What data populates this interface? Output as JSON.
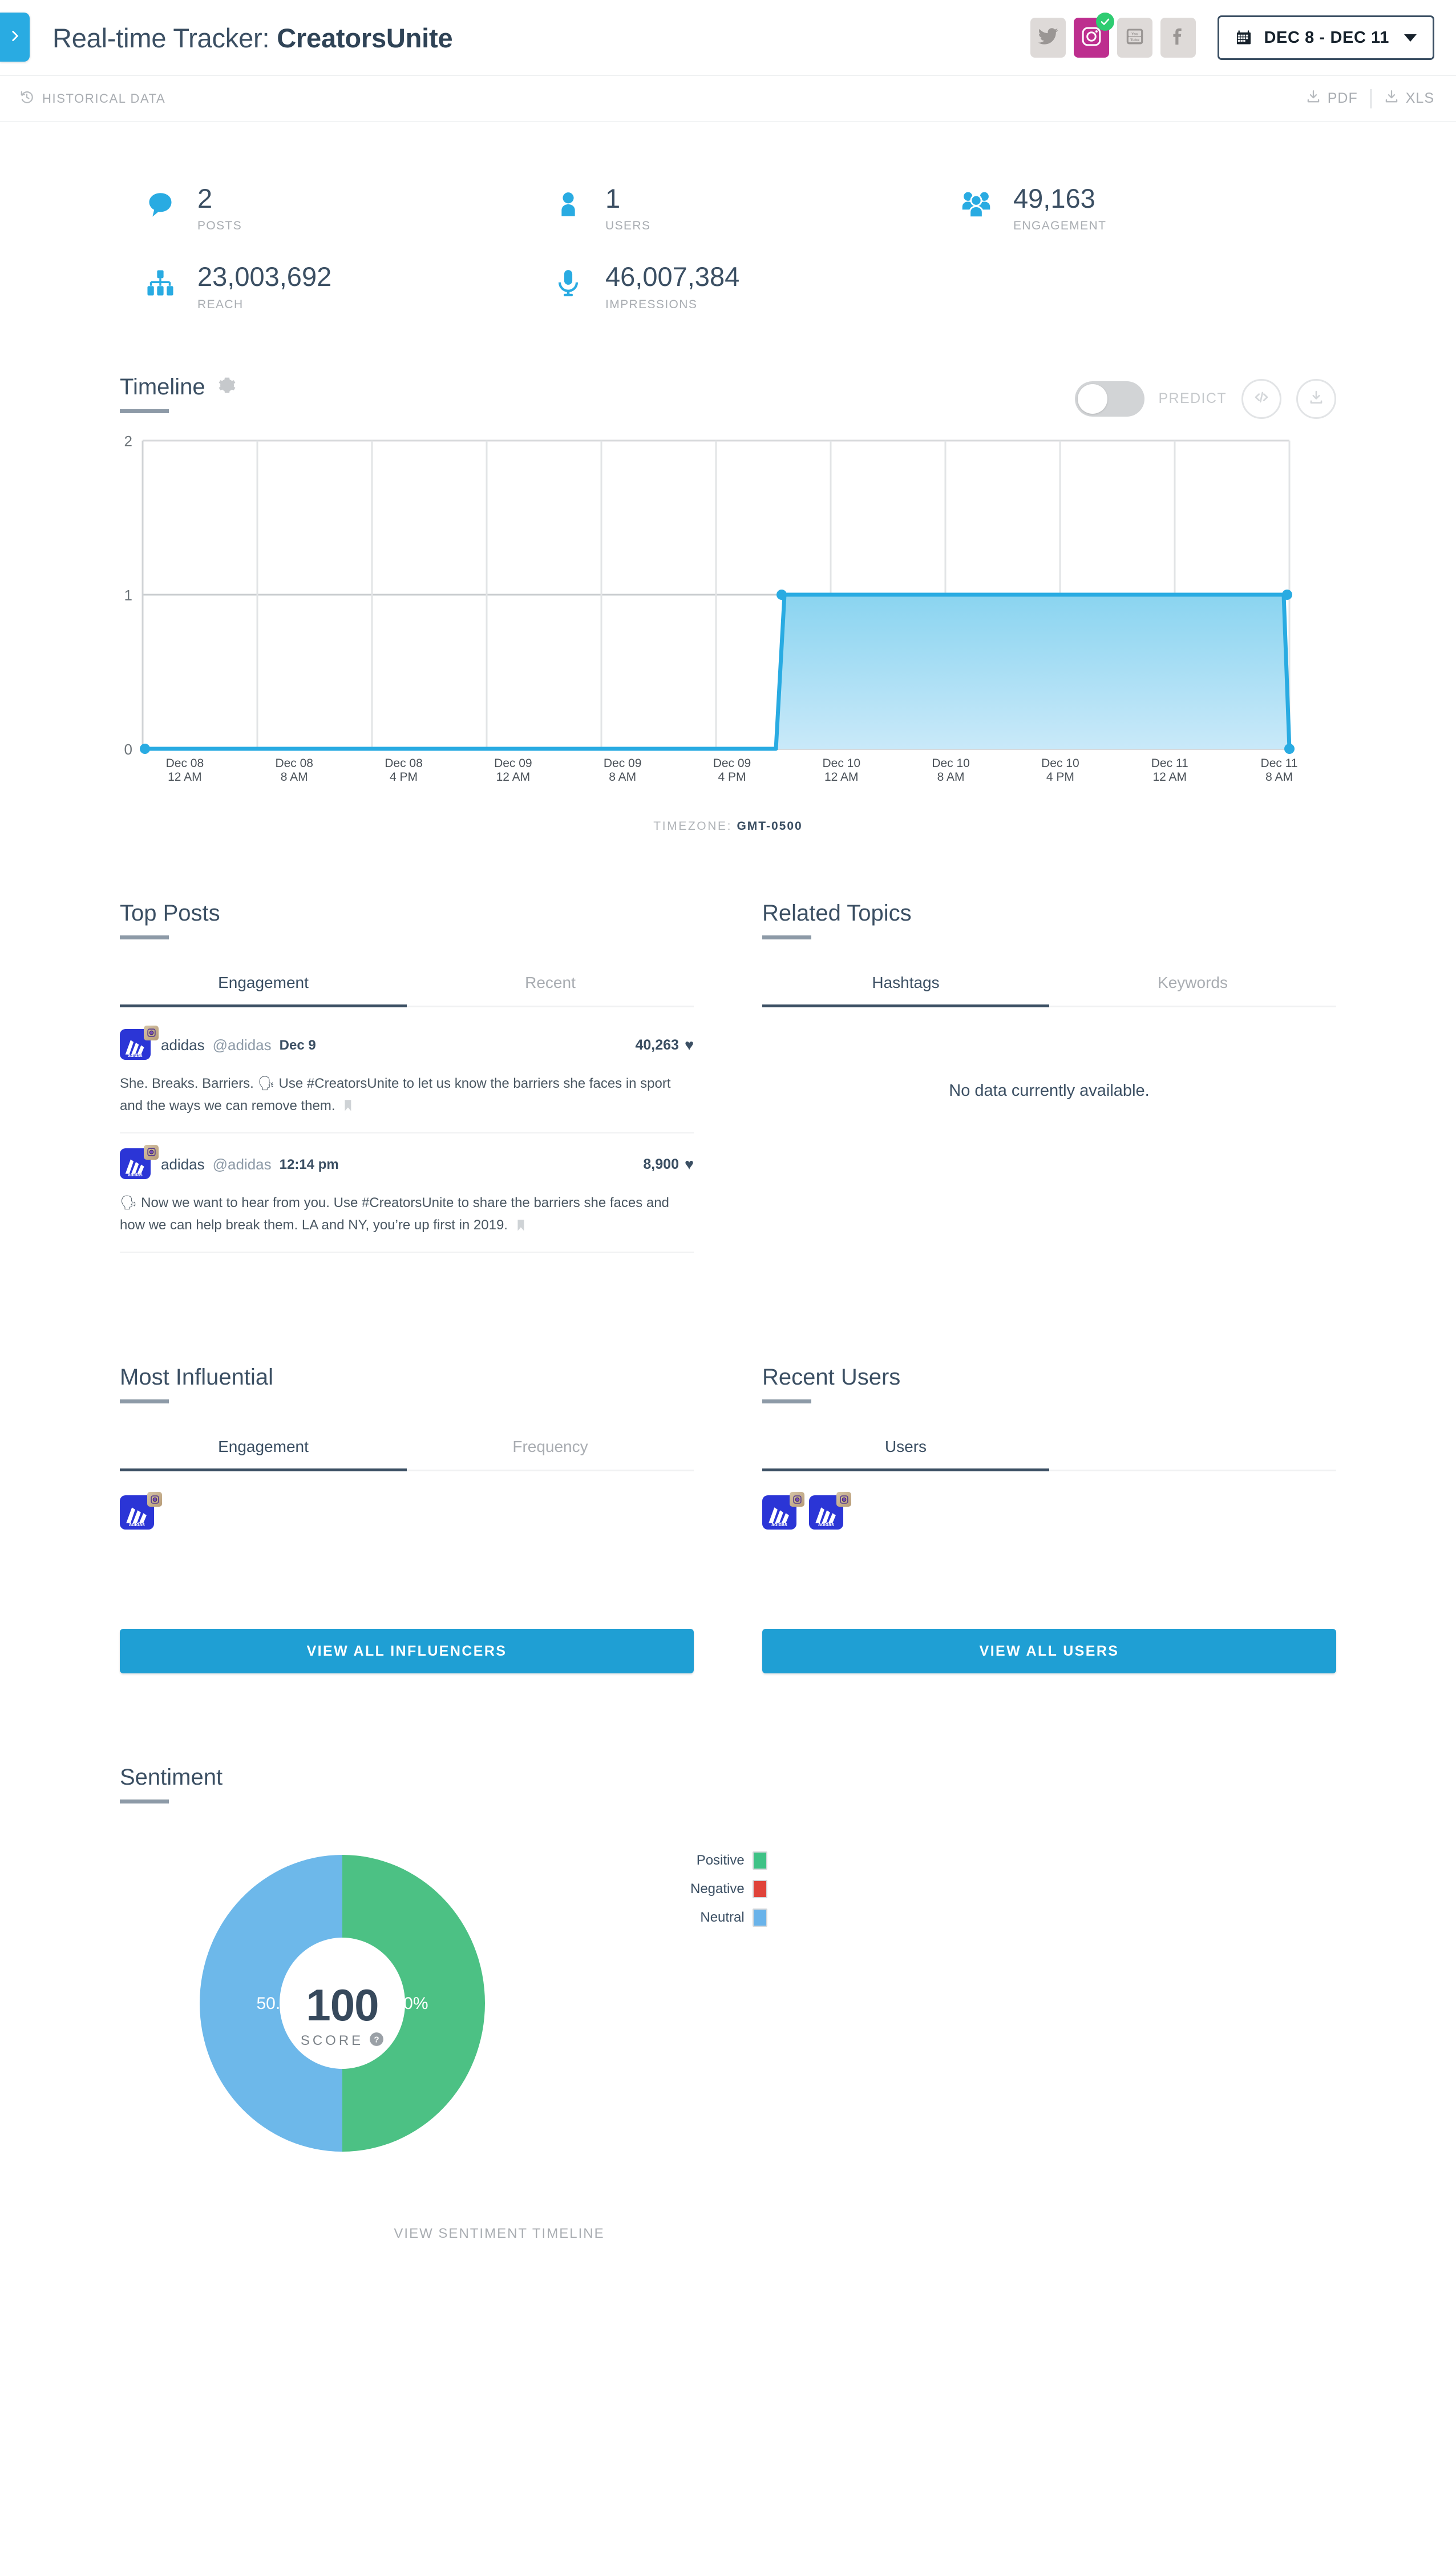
{
  "header": {
    "toggle_icon": "chevron-right-icon",
    "title_prefix": "Real-time Tracker: ",
    "title_campaign": "CreatorsUnite",
    "social": [
      {
        "name": "twitter",
        "label": "Twitter",
        "active": false
      },
      {
        "name": "instagram",
        "label": "Instagram",
        "active": true
      },
      {
        "name": "youtube",
        "label": "YouTube",
        "active": false
      },
      {
        "name": "facebook",
        "label": "Facebook",
        "active": false
      }
    ],
    "date_range": "DEC 8 - DEC 11"
  },
  "subbar": {
    "historical_label": "HISTORICAL DATA",
    "pdf_label": "PDF",
    "xls_label": "XLS"
  },
  "stats": [
    {
      "value": "2",
      "label": "POSTS",
      "icon": "comment-bubble-icon"
    },
    {
      "value": "1",
      "label": "USERS",
      "icon": "user-icon"
    },
    {
      "value": "49,163",
      "label": "ENGAGEMENT",
      "icon": "users-group-icon"
    },
    {
      "value": "23,003,692",
      "label": "REACH",
      "icon": "network-icon"
    },
    {
      "value": "46,007,384",
      "label": "IMPRESSIONS",
      "icon": "microphone-icon"
    }
  ],
  "timeline": {
    "title": "Timeline",
    "gear_icon": "gear-icon",
    "predict_label": "PREDICT",
    "predict_on": false,
    "embed_icon": "code-icon",
    "download_icon": "download-icon",
    "timezone_label": "TIMEZONE:",
    "timezone_value": "GMT-0500"
  },
  "chart_data": {
    "type": "area",
    "title": "Timeline",
    "xlabel": "",
    "ylabel": "",
    "ylim": [
      0,
      2
    ],
    "yticks": [
      "0",
      "1",
      "2"
    ],
    "grid": true,
    "legend": "none",
    "x": [
      "Dec 08 12 AM",
      "Dec 08 8 AM",
      "Dec 08 4 PM",
      "Dec 09 12 AM",
      "Dec 09 8 AM",
      "Dec 09 4 PM",
      "Dec 10 12 AM",
      "Dec 10 8 AM",
      "Dec 10 4 PM",
      "Dec 11 12 AM",
      "Dec 11 8 AM"
    ],
    "tick_labels_line1": [
      "Dec 08",
      "Dec 08",
      "Dec 08",
      "Dec 09",
      "Dec 09",
      "Dec 09",
      "Dec 10",
      "Dec 10",
      "Dec 10",
      "Dec 11",
      "Dec 11"
    ],
    "tick_labels_line2": [
      "12 AM",
      "8 AM",
      "4 PM",
      "12 AM",
      "8 AM",
      "4 PM",
      "12 AM",
      "8 AM",
      "4 PM",
      "12 AM",
      "8 AM"
    ],
    "values": [
      0,
      0,
      0,
      0,
      0,
      0,
      1,
      1,
      1,
      1,
      1
    ],
    "end_value": 0,
    "series_color": "#29abe2",
    "fill_color_top": "#8ad4f0",
    "fill_color_bottom": "#c5e8f8"
  },
  "top_posts": {
    "title": "Top Posts",
    "tabs": [
      {
        "label": "Engagement",
        "active": true
      },
      {
        "label": "Recent",
        "active": false
      }
    ],
    "posts": [
      {
        "name": "adidas",
        "handle": "@adidas",
        "time": "Dec 9",
        "engagement": "40,263",
        "text": "She. Breaks. Barriers. 🗣 Use #CreatorsUnite to let us know the barriers she faces in sport and the ways we can remove them.",
        "network": "instagram"
      },
      {
        "name": "adidas",
        "handle": "@adidas",
        "time": "12:14 pm",
        "engagement": "8,900",
        "text": "🗣 Now we want to hear from you. Use #CreatorsUnite to share the barriers she faces and how we can help break them. LA and NY, you’re up first in 2019.",
        "network": "instagram"
      }
    ]
  },
  "related_topics": {
    "title": "Related Topics",
    "tabs": [
      {
        "label": "Hashtags",
        "active": true
      },
      {
        "label": "Keywords",
        "active": false
      }
    ],
    "empty_message": "No data currently available."
  },
  "most_influential": {
    "title": "Most Influential",
    "tabs": [
      {
        "label": "Engagement",
        "active": true
      },
      {
        "label": "Frequency",
        "active": false
      }
    ],
    "avatars": [
      {
        "name": "adidas",
        "network": "instagram"
      }
    ],
    "cta_label": "VIEW ALL INFLUENCERS"
  },
  "recent_users": {
    "title": "Recent Users",
    "tabs": [
      {
        "label": "Users",
        "active": true
      }
    ],
    "avatars": [
      {
        "name": "adidas",
        "network": "instagram"
      },
      {
        "name": "adidas",
        "network": "instagram"
      }
    ],
    "cta_label": "VIEW ALL USERS"
  },
  "sentiment": {
    "title": "Sentiment",
    "score": "100",
    "score_label": "SCORE",
    "help_icon": "question-mark-icon",
    "left_pct": "50.0%",
    "right_pct": "50.0%",
    "legend": [
      {
        "label": "Positive",
        "color": "#3ec286"
      },
      {
        "label": "Negative",
        "color": "#e0433a"
      },
      {
        "label": "Neutral",
        "color": "#69b3ea"
      }
    ],
    "view_timeline_label": "VIEW SENTIMENT TIMELINE",
    "chart": {
      "type": "pie",
      "categories": [
        "Positive",
        "Neutral",
        "Negative"
      ],
      "values": [
        50.0,
        50.0,
        0.0
      ],
      "colors": [
        "#3ec286",
        "#69b3ea",
        "#e0433a"
      ]
    }
  }
}
